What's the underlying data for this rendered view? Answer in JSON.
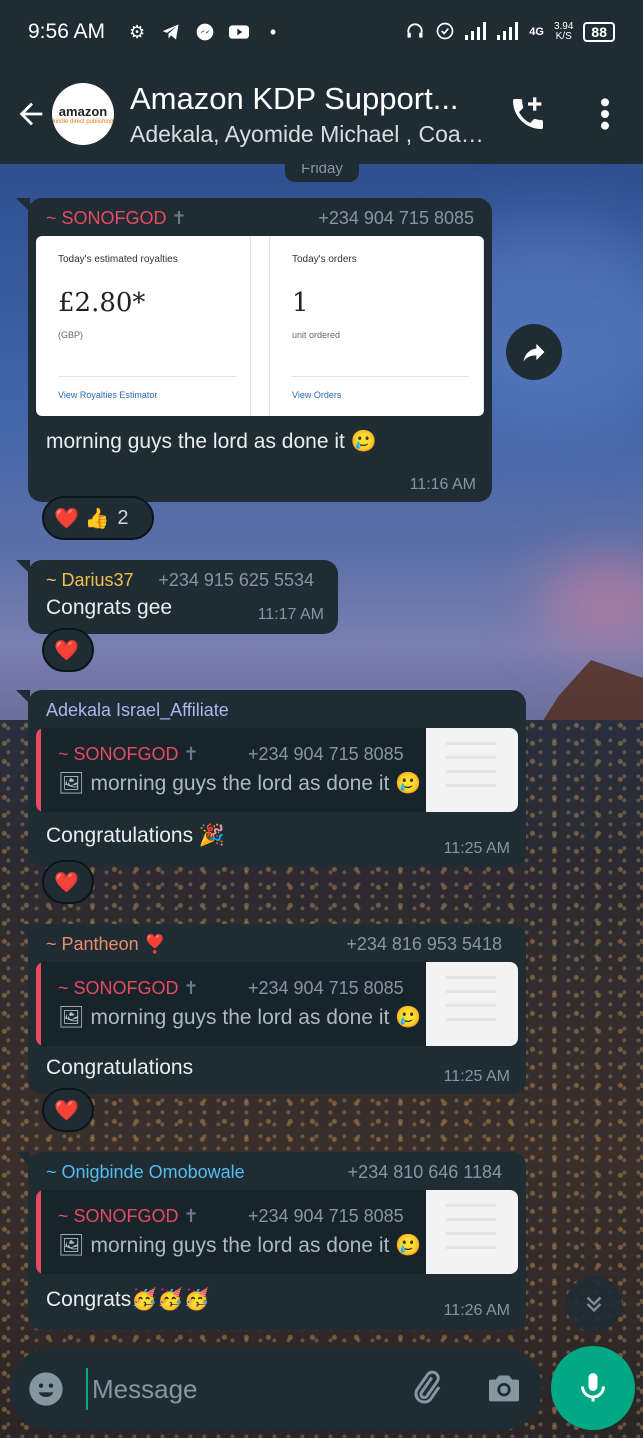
{
  "status_bar": {
    "time": "9:56 AM",
    "network": "4G",
    "speed_value": "3.94",
    "speed_unit": "K/S",
    "battery": "88"
  },
  "header": {
    "title": "Amazon KDP Support...",
    "subtitle": "Adekala, Ayomide Michael , Coac...",
    "avatar_text_1": "amazon",
    "avatar_text_2": "kindle direct publishing"
  },
  "date_chip": "Friday",
  "messages": [
    {
      "sender": "~ SONOFGOD",
      "sender_color": "#e84a5f",
      "phone": "+234 904 715 8085",
      "screenshot": {
        "left": {
          "label": "Today's estimated royalties",
          "value": "£2.80*",
          "sub": "(GBP)",
          "link": "View Royalties Estimator"
        },
        "right": {
          "label": "Today's orders",
          "value": "1",
          "sub": "unit ordered",
          "link": "View Orders"
        }
      },
      "text": "morning guys the lord as done it 🥲",
      "time": "11:16 AM",
      "reactions": {
        "emojis": "❤️ 👍",
        "count": "2"
      }
    },
    {
      "sender": "~ Darius37",
      "sender_color": "#f5c04a",
      "phone": "+234 915 625 5534",
      "text": "Congrats gee",
      "time": "11:17 AM",
      "reactions": {
        "emojis": "❤️"
      }
    },
    {
      "sender": "Adekala Israel_Affiliate",
      "sender_color": "#a8b8f0",
      "quote": {
        "name": "~ SONOFGOD",
        "phone": "+234 904 715 8085",
        "text": "🖼 morning guys the lord as done it 🥲"
      },
      "text": "Congratulations 🎉",
      "time": "11:25 AM",
      "reactions": {
        "emojis": "❤️"
      }
    },
    {
      "sender": "~ Pantheon ❣️",
      "sender_color": "#f08a6a",
      "phone": "+234 816 953 5418",
      "quote": {
        "name": "~ SONOFGOD",
        "phone": "+234 904 715 8085",
        "text": "🖼 morning guys the lord as done it 🥲"
      },
      "text": "Congratulations",
      "time": "11:25 AM",
      "reactions": {
        "emojis": "❤️"
      }
    },
    {
      "sender": "~ Onigbinde Omobowale",
      "sender_color": "#53bdeb",
      "phone": "+234 810 646 1184",
      "quote": {
        "name": "~ SONOFGOD",
        "phone": "+234 904 715 8085",
        "text": "🖼 morning guys the lord as done it 🥲"
      },
      "text": "Congrats🥳🥳🥳",
      "time": "11:26 AM"
    }
  ],
  "composer": {
    "placeholder": "Message"
  },
  "colors": {
    "header_bg": "#1f2c34",
    "bubble_bg": "#1f2c34",
    "accent": "#00a884"
  }
}
